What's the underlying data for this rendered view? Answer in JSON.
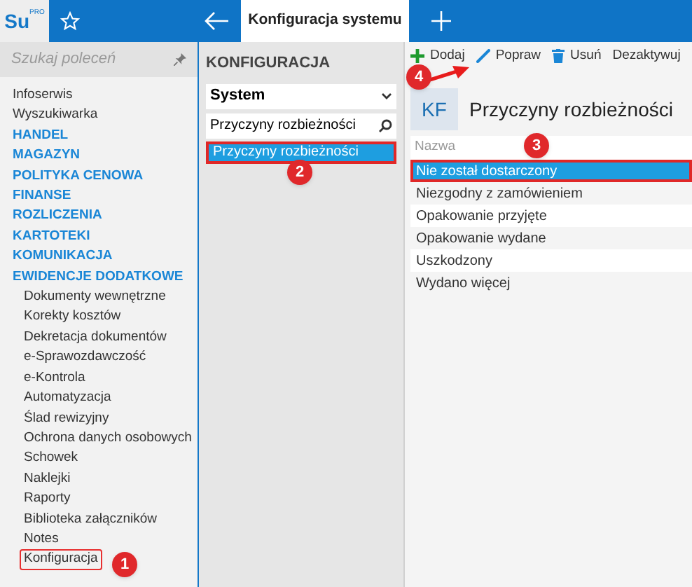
{
  "logo": {
    "text": "Su",
    "badge": "PRO"
  },
  "tab": {
    "label": "Konfiguracja systemu",
    "selected": true
  },
  "sidebar": {
    "search": {
      "placeholder": "Szukaj poleceń"
    },
    "items": [
      {
        "label": "Infoserwis",
        "kind": "link",
        "outlined": false
      },
      {
        "label": "Wyszukiwarka",
        "kind": "link",
        "outlined": false
      },
      {
        "label": "HANDEL",
        "kind": "section",
        "outlined": false
      },
      {
        "label": "MAGAZYN",
        "kind": "section",
        "outlined": false
      },
      {
        "label": "POLITYKA CENOWA",
        "kind": "section",
        "outlined": false
      },
      {
        "label": "FINANSE",
        "kind": "section",
        "outlined": false
      },
      {
        "label": "ROZLICZENIA",
        "kind": "section",
        "outlined": false
      },
      {
        "label": "KARTOTEKI",
        "kind": "section",
        "outlined": false
      },
      {
        "label": "KOMUNIKACJA",
        "kind": "section",
        "outlined": false
      },
      {
        "label": "EWIDENCJE DODATKOWE",
        "kind": "section",
        "outlined": false
      },
      {
        "label": "Dokumenty wewnętrzne",
        "kind": "sub",
        "outlined": false
      },
      {
        "label": "Korekty kosztów",
        "kind": "sub",
        "outlined": false
      },
      {
        "label": "Dekretacja dokumentów",
        "kind": "sub",
        "outlined": false
      },
      {
        "label": "e-Sprawozdawczość",
        "kind": "sub",
        "outlined": false
      },
      {
        "label": "e-Kontrola",
        "kind": "sub",
        "outlined": false
      },
      {
        "label": "Automatyzacja",
        "kind": "sub",
        "outlined": false
      },
      {
        "label": "Ślad rewizyjny",
        "kind": "sub",
        "outlined": false
      },
      {
        "label": "Ochrona danych osobowych",
        "kind": "sub",
        "outlined": false
      },
      {
        "label": "Schowek",
        "kind": "sub",
        "outlined": false
      },
      {
        "label": "Naklejki",
        "kind": "sub",
        "outlined": false
      },
      {
        "label": "Raporty",
        "kind": "sub",
        "outlined": false
      },
      {
        "label": "Biblioteka załączników",
        "kind": "sub",
        "outlined": false
      },
      {
        "label": "Notes",
        "kind": "sub",
        "outlined": false
      },
      {
        "label": "Konfiguracja",
        "kind": "sub",
        "outlined": true
      }
    ]
  },
  "config": {
    "heading": "KONFIGURACJA",
    "dropdown": "System",
    "search": "Przyczyny rozbieżności",
    "items": [
      {
        "label": "Przyczyny rozbieżności",
        "selected": true,
        "outlined": true
      }
    ]
  },
  "toolbar": [
    {
      "label": "Dodaj",
      "kind": "add"
    },
    {
      "label": "Popraw",
      "kind": "edit"
    },
    {
      "label": "Usuń",
      "kind": "delete"
    },
    {
      "label": "Dezaktywuj",
      "kind": "text"
    }
  ],
  "detail": {
    "badge": "KF",
    "title": "Przyczyny rozbieżności",
    "table": {
      "columns": [
        "Nazwa"
      ],
      "rows": [
        {
          "cells": [
            "Nie został dostarczony"
          ],
          "selected": true,
          "outlined": true
        },
        {
          "cells": [
            "Niezgodny z zamówieniem"
          ],
          "selected": false,
          "outlined": false
        },
        {
          "cells": [
            "Opakowanie przyjęte"
          ],
          "selected": false,
          "outlined": false
        },
        {
          "cells": [
            "Opakowanie wydane"
          ],
          "selected": false,
          "outlined": false
        },
        {
          "cells": [
            "Uszkodzony"
          ],
          "selected": false,
          "outlined": false
        },
        {
          "cells": [
            "Wydano więcej"
          ],
          "selected": false,
          "outlined": false
        }
      ]
    }
  },
  "callouts": [
    {
      "label": "1"
    },
    {
      "label": "2"
    },
    {
      "label": "3"
    },
    {
      "label": "4"
    }
  ]
}
